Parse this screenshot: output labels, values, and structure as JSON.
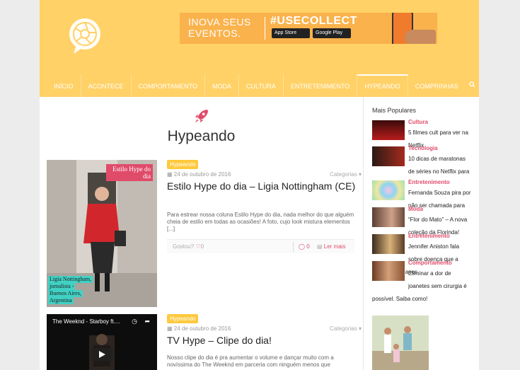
{
  "banner": {
    "line1": "INOVA SEUS",
    "line2": "EVENTOS.",
    "hashtag": "#USECOLLECT",
    "app_store": "App Store",
    "google_play": "Google Play"
  },
  "nav": {
    "items": [
      {
        "label": "Início"
      },
      {
        "label": "Acontece"
      },
      {
        "label": "Comportamento"
      },
      {
        "label": "Moda"
      },
      {
        "label": "Cultura"
      },
      {
        "label": "Entretenimento"
      },
      {
        "label": "Hypeando"
      },
      {
        "label": "Comprinhas"
      }
    ],
    "active": "Hypeando"
  },
  "page": {
    "title": "Hypeando"
  },
  "posts": [
    {
      "tag": "Hypeando",
      "date": "24 de outubro de 2016",
      "categories": "Categorias",
      "title": "Estilo Hype do dia – Ligia Nottingham (CE)",
      "excerpt": "Para estrear nossa coluna Estilo Hype do dia, nada melhor do que alguém cheia de estilo em todas as ocasiões! A foto, cujo look mistura elementos [...]",
      "liked_label": "Gostou?",
      "likes": "0",
      "comments": "0",
      "read_more": "Ler mais",
      "thumb_caption_top": "Estilo Hype do dia",
      "thumb_caption_bottom": [
        "Ligia Nottingham,",
        "jornalista -",
        "Buenos Aires,",
        "Argentina"
      ]
    },
    {
      "tag": "Hypeando",
      "date": "24 de outubro de 2016",
      "categories": "Categorias",
      "title": "TV Hype – Clipe do dia!",
      "excerpt": "Nosso clipe do dia é pra aumentar o volume e dançar muito com a novíssima do The Weeknd em parceria com ninguém menos que",
      "video_title": "The Weeknd - Starboy ft...."
    }
  ],
  "sidebar": {
    "title": "Mais Populares",
    "items": [
      {
        "category": "Cultura",
        "title": "5 filmes cult para ver na Netflix"
      },
      {
        "category": "Tecnologia",
        "title": "10 dicas de maratonas de séries no Netflix para o feriadão"
      },
      {
        "category": "Entretenimento",
        "title": "Fernanda Souza pira por não ser chamada para Vídeo Show"
      },
      {
        "category": "Moda",
        "title": "“Flor do Mato” – A nova coleção da Florinda!"
      },
      {
        "category": "Entretenimento",
        "title": "Jennifer Aniston fala sobre doença que a atrapalha há anos"
      },
      {
        "category": "Comportamento",
        "title": "Eliminar a dor de joanetes sem cirurgia é possível. Saiba como!"
      }
    ]
  }
}
